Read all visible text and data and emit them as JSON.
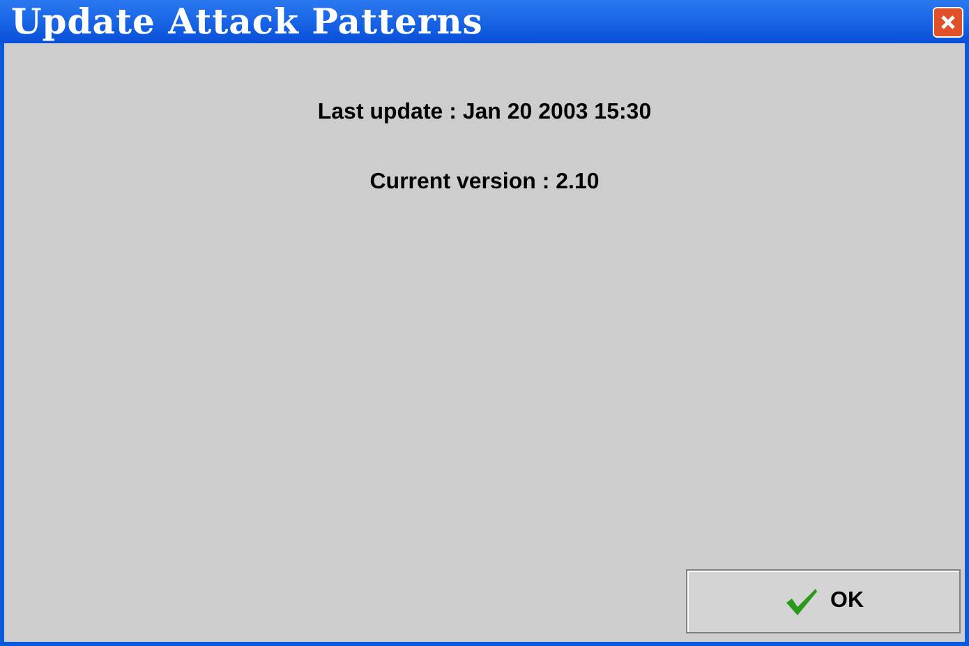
{
  "window": {
    "title": "Update Attack Patterns"
  },
  "lines": [
    {
      "label": "Last update :",
      "value": "Jan 20 2003 15:30"
    },
    {
      "label": "Current version :",
      "value": "2.10"
    }
  ],
  "buttons": [
    {
      "label": "OK",
      "kind": "ok"
    }
  ]
}
